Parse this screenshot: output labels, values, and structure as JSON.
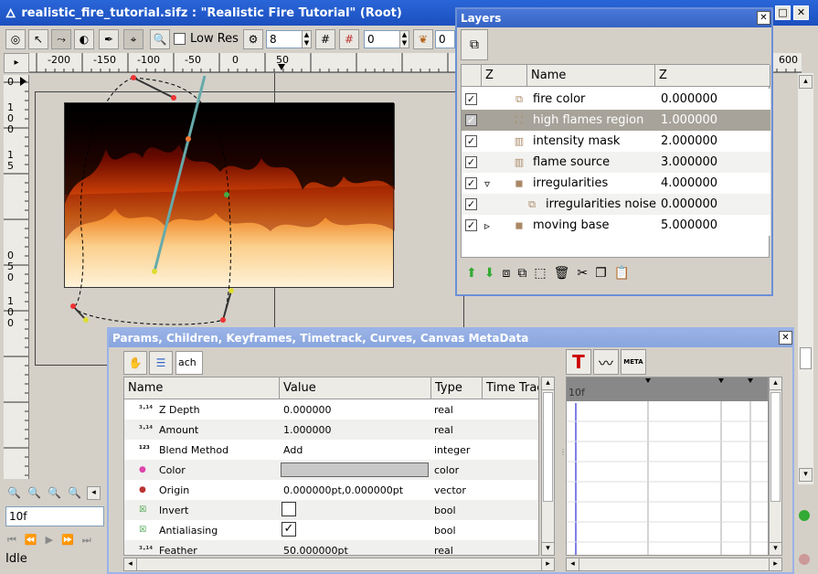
{
  "window": {
    "title": "realistic_fire_tutorial.sifz : \"Realistic Fire Tutorial\" (Root)",
    "btn_min": "_",
    "btn_max": "□",
    "btn_close": "✕"
  },
  "toolbar": {
    "low_res_label": "Low Res",
    "spin1_value": "8",
    "spin2_value": "0",
    "spin3_value": "0"
  },
  "ruler": {
    "h_ticks": [
      "-200",
      "-150",
      "-100",
      "-50",
      "0",
      "50",
      "600"
    ],
    "v_ticks": [
      "0",
      "1",
      "0",
      "0",
      "1",
      "5",
      "0",
      "5",
      "0",
      "1",
      "0",
      "0"
    ]
  },
  "canvas_left": {
    "frame_value": "10f",
    "status": "Idle"
  },
  "layers": {
    "title": "Layers",
    "col_z1": "Z",
    "col_name": "Name",
    "col_z2": "Z",
    "rows": [
      {
        "name": "fire color",
        "z": "0.000000",
        "icon": "layer-stack-icon",
        "selected": false,
        "expander": ""
      },
      {
        "name": "high flames region",
        "z": "1.000000",
        "icon": "region-icon",
        "selected": true,
        "expander": ""
      },
      {
        "name": "intensity mask",
        "z": "2.000000",
        "icon": "gradient-icon",
        "selected": false,
        "expander": ""
      },
      {
        "name": "flame source",
        "z": "3.000000",
        "icon": "gradient-icon",
        "selected": false,
        "expander": ""
      },
      {
        "name": "irregularities",
        "z": "4.000000",
        "icon": "group-icon",
        "selected": false,
        "expander": "▿"
      },
      {
        "name": "irregularities noise",
        "z": "0.000000",
        "icon": "layer-stack-icon",
        "selected": false,
        "expander": ""
      },
      {
        "name": "moving base",
        "z": "5.000000",
        "icon": "group-icon",
        "selected": false,
        "expander": "▹"
      }
    ]
  },
  "params": {
    "title": "Params, Children, Keyframes, Timetrack, Curves, Canvas MetaData",
    "tab_text": "ach",
    "col_name": "Name",
    "col_value": "Value",
    "col_type": "Type",
    "col_timetrack": "Time Track",
    "rows": [
      {
        "name": "Z Depth",
        "value": "0.000000",
        "type": "real",
        "icon": "real-icon"
      },
      {
        "name": "Amount",
        "value": "1.000000",
        "type": "real",
        "icon": "real-icon"
      },
      {
        "name": "Blend Method",
        "value": "Add",
        "type": "integer",
        "icon": "integer-icon"
      },
      {
        "name": "Color",
        "value": "",
        "type": "color",
        "icon": "color-wheel-icon"
      },
      {
        "name": "Origin",
        "value": "0.000000pt,0.000000pt",
        "type": "vector",
        "icon": "vector-icon"
      },
      {
        "name": "Invert",
        "value": "",
        "type": "bool",
        "icon": "bool-icon"
      },
      {
        "name": "Antialiasing",
        "value": "✓",
        "type": "bool",
        "icon": "bool-icon"
      },
      {
        "name": "Feather",
        "value": "50.000000pt",
        "type": "real",
        "icon": "real-icon"
      }
    ],
    "meta_label": "META",
    "t_label": "T",
    "timebar_label": "10f"
  },
  "colors": {
    "titlebar": "#1c4fbf",
    "selected_row": "#a7a39a",
    "color_param": "#c8c8c8"
  }
}
